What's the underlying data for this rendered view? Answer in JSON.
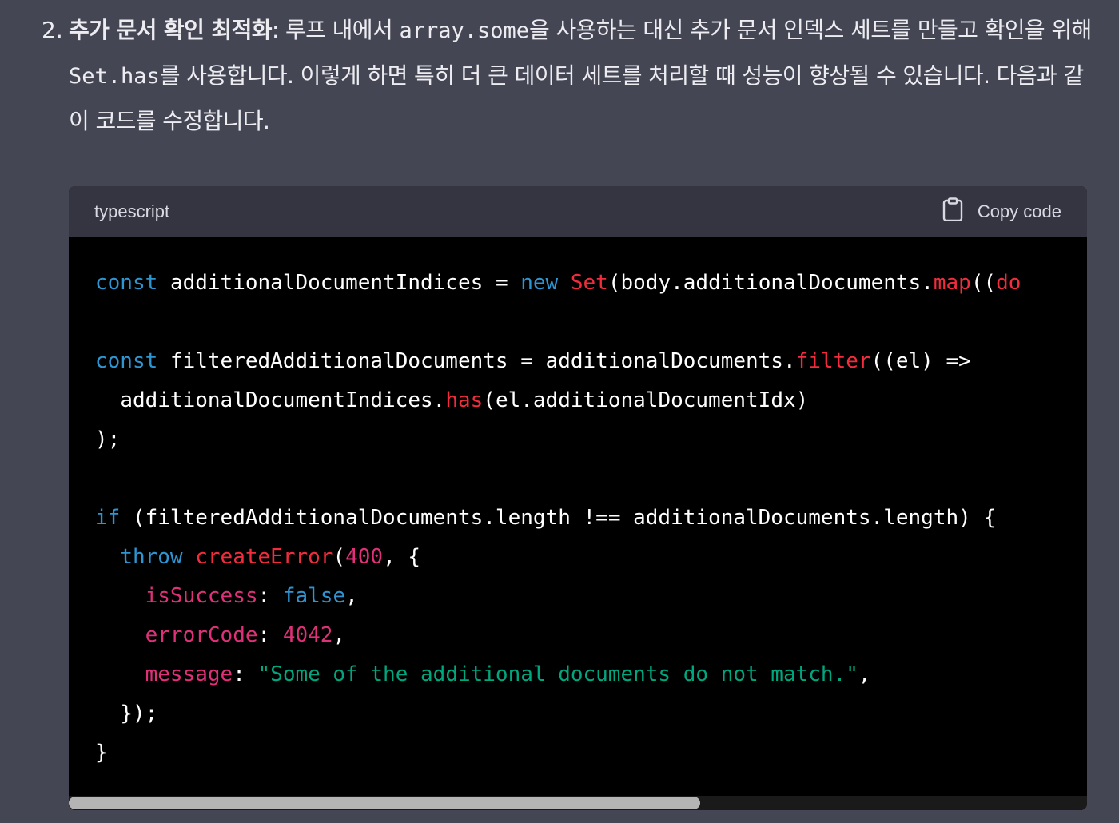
{
  "answer": {
    "item_number": "2.",
    "heading": "추가 문서 확인 최적화",
    "text_1": ": 루프 내에서 ",
    "code_1": "array.some",
    "text_2": "을 사용하는 대신 추가 문서 인덱스 세트를 만들고 확인을 위해 ",
    "code_2": "Set.has",
    "text_3": "를 사용합니다. 이렇게 하면 특히 더 큰 데이터 세트를 처리할 때 성능이 향상될 수 있습니다. 다음과 같이 코드를 수정합니다."
  },
  "code_block": {
    "language": "typescript",
    "copy_label": "Copy code",
    "copy_icon": "clipboard-icon",
    "colors": {
      "keyword": "#2e95d3",
      "function": "#f22c3d",
      "property": "#df3079",
      "string": "#00a67d"
    },
    "lines": [
      "const additionalDocumentIndices = new Set(body.additionalDocuments.map((do",
      "",
      "const filteredAdditionalDocuments = additionalDocuments.filter((el) =>",
      "  additionalDocumentIndices.has(el.additionalDocumentIdx)",
      ");",
      "",
      "if (filteredAdditionalDocuments.length !== additionalDocuments.length) {",
      "  throw createError(400, {",
      "    isSuccess: false,",
      "    errorCode: 4042,",
      "    message: \"Some of the additional documents do not match.\",",
      "  });",
      "}"
    ]
  },
  "scrollbar": {
    "position_fraction": 0.0,
    "visible_fraction": 0.62
  }
}
